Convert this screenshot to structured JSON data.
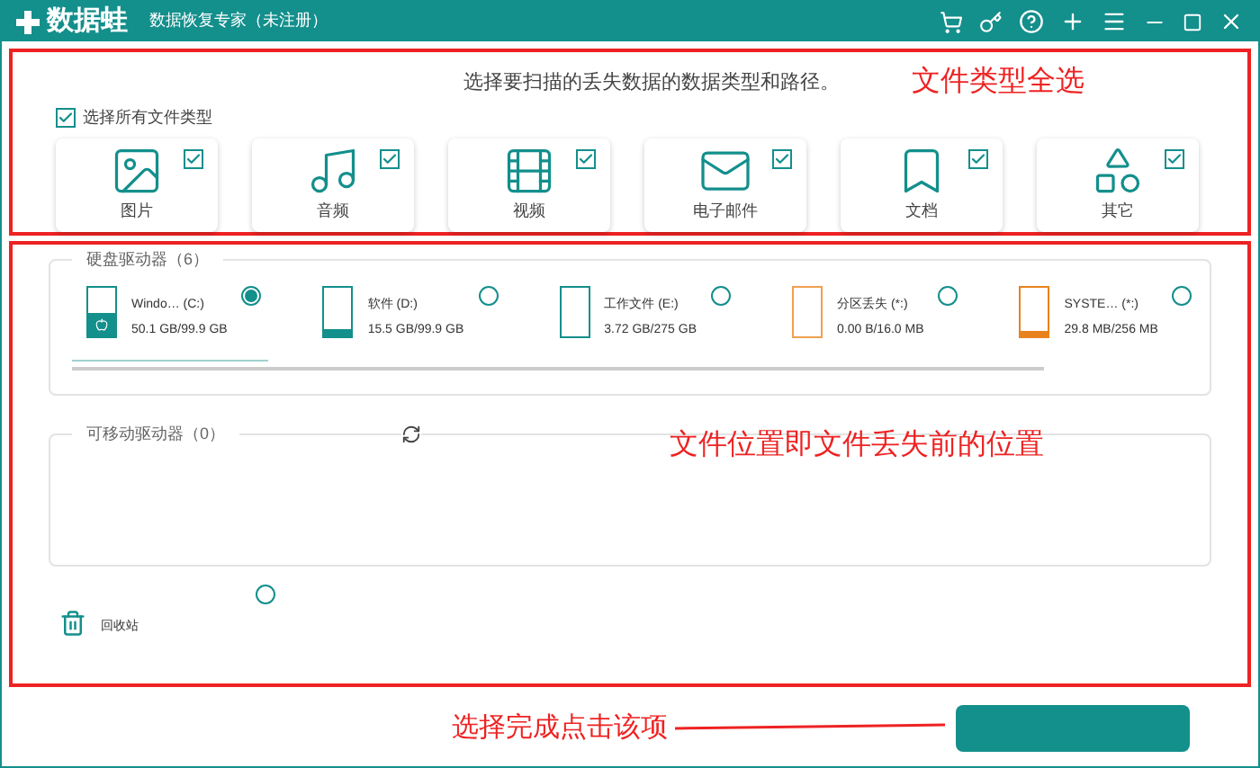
{
  "window": {
    "app_name": "数据蛙",
    "title": "数据恢复专家（未注册）"
  },
  "file_types": {
    "prompt": "选择要扫描的丢失数据的数据类型和路径。",
    "select_all": {
      "label": "选择所有文件类型",
      "checked": true
    },
    "items": [
      {
        "kind": "image",
        "label": "图片",
        "checked": true
      },
      {
        "kind": "audio",
        "label": "音频",
        "checked": true
      },
      {
        "kind": "video",
        "label": "视频",
        "checked": true
      },
      {
        "kind": "email",
        "label": "电子邮件",
        "checked": true
      },
      {
        "kind": "document",
        "label": "文档",
        "checked": true
      },
      {
        "kind": "other",
        "label": "其它",
        "checked": true
      }
    ]
  },
  "hard_drives": {
    "title": "硬盘驱动器（6）",
    "drives": [
      {
        "name": "Windo… (C:)",
        "usage": "50.1 GB/99.9 GB",
        "level": 0.5,
        "color": "#138f8c",
        "selected": true,
        "windows": true
      },
      {
        "name": "软件 (D:)",
        "usage": "15.5 GB/99.9 GB",
        "level": 0.16,
        "color": "#138f8c",
        "selected": false,
        "windows": false
      },
      {
        "name": "工作文件 (E:)",
        "usage": "3.72 GB/275 GB",
        "level": 0.01,
        "color": "#138f8c",
        "selected": false,
        "windows": false
      },
      {
        "name": "分区丢失 (*:)",
        "usage": "0.00  B/16.0 MB",
        "level": 0,
        "color": "#f0a050",
        "selected": false,
        "windows": false
      },
      {
        "name": "SYSTE… (*:)",
        "usage": "29.8 MB/256 MB",
        "level": 0.12,
        "color": "#e8821e",
        "selected": false,
        "windows": false
      }
    ]
  },
  "removable_drives": {
    "title": "可移动驱动器（0）"
  },
  "recycle_bin": {
    "label": "回收站",
    "selected": false
  },
  "annotations": [
    "文件类型全选",
    "文件位置即文件丢失前的位置",
    "选择完成点击该项"
  ]
}
